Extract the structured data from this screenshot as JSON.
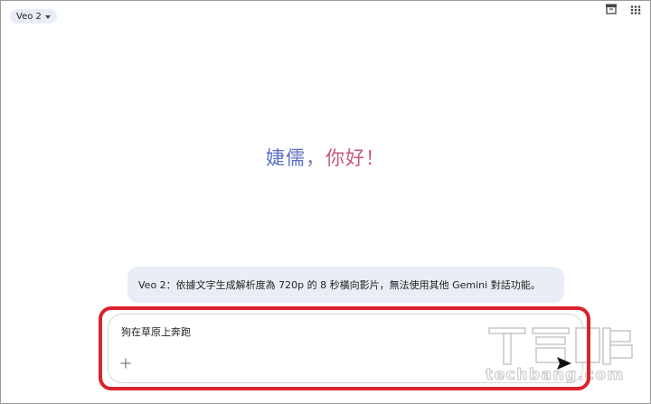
{
  "model_selector": {
    "label": "Veo 2"
  },
  "greeting": {
    "name": "婕儒",
    "separator": "，",
    "hello": "你好！"
  },
  "info_banner": {
    "text": "Veo 2：依據文字生成解析度為 720p 的 8 秒橫向影片，無法使用其他 Gemini 對話功能。"
  },
  "prompt": {
    "value": "狗在草原上奔跑"
  },
  "icons": {
    "archive": "archive-icon",
    "apps": "apps-grid-icon",
    "add": "plus-icon",
    "send": "send-icon"
  },
  "watermark": {
    "text": "techbang.com"
  },
  "colors": {
    "highlight": "#d9232d",
    "chip_bg": "#e9eef6",
    "greeting_name": "#5b6fc4",
    "greeting_hello": "#c65a7a"
  }
}
